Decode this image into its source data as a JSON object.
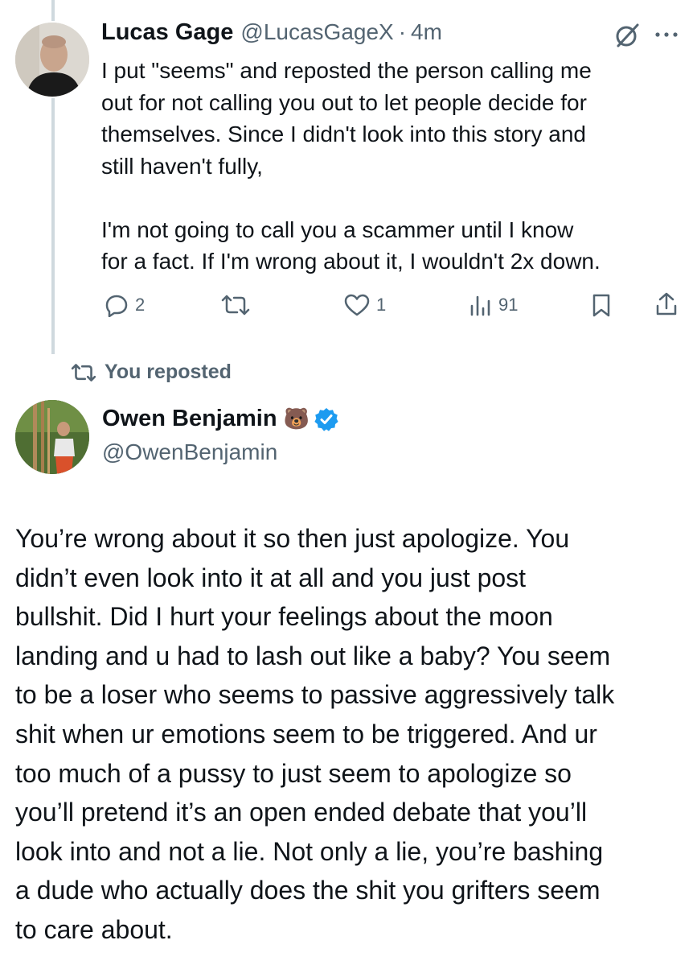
{
  "tweet1": {
    "display_name": "Lucas Gage",
    "handle": "@LucasGageX",
    "separator": "·",
    "time": "4m",
    "text": "I put \"seems\" and reposted the person calling me\nout for not calling you out to let people decide for\nthemselves. Since I didn't look into this story and\nstill haven't fully,\n\nI'm not going to call you a scammer until I know\nfor a fact. If I'm wrong about it, I wouldn't 2x down.",
    "actions": {
      "replies": "2",
      "reposts": "",
      "likes": "1",
      "views": "91"
    },
    "icons": [
      "grok-icon",
      "more-icon",
      "reply-icon",
      "repost-icon",
      "like-icon",
      "views-icon",
      "bookmark-icon",
      "share-icon"
    ]
  },
  "repost_banner": {
    "label": "You reposted"
  },
  "tweet2": {
    "display_name": "Owen Benjamin",
    "emoji": "🐻",
    "handle": "@OwenBenjamin",
    "verified": true,
    "text": "You’re wrong about it so then just apologize. You\ndidn’t even look into it at all and you just post\nbullshit. Did I hurt your feelings about the moon\nlanding and u had to lash out like a baby? You seem\nto be a loser who seems to passive aggressively talk\nshit when ur emotions seem to be triggered. And ur\ntoo much of a pussy to just seem to apologize so\nyou’ll pretend it’s an open ended debate that you’ll\nlook into and not a lie. Not only a lie, you’re bashing\na dude who actually does the shit you grifters seem\nto care about."
  },
  "colors": {
    "text": "#0f1419",
    "muted": "#536471",
    "verified": "#1d9bf0",
    "thread_line": "#cfd9de"
  }
}
